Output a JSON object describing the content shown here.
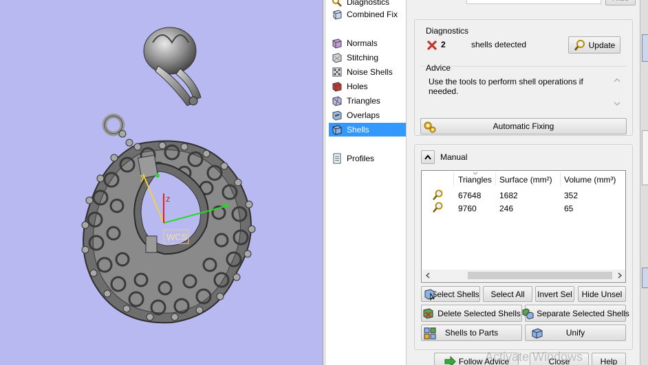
{
  "viewport": {
    "wcs_label": "WCS",
    "axis_y": "y",
    "axis_z": "z",
    "background": "#b9b9f2"
  },
  "tools": {
    "items": [
      {
        "label": "Diagnostics",
        "icon": "diagnostics-icon"
      },
      {
        "label": "Combined Fix",
        "icon": "combined-fix-icon"
      },
      {
        "label": "Normals",
        "icon": "normals-icon"
      },
      {
        "label": "Stitching",
        "icon": "stitching-icon"
      },
      {
        "label": "Noise Shells",
        "icon": "noise-shells-icon"
      },
      {
        "label": "Holes",
        "icon": "holes-icon"
      },
      {
        "label": "Triangles",
        "icon": "triangles-icon"
      },
      {
        "label": "Overlaps",
        "icon": "overlaps-icon"
      },
      {
        "label": "Shells",
        "icon": "shells-icon",
        "selected": true
      },
      {
        "label": "Profiles",
        "icon": "profiles-icon"
      }
    ],
    "selection_color": "#3399ff"
  },
  "diagnostics": {
    "title": "Diagnostics",
    "count": "2",
    "message": "shells detected",
    "update_label": "Update",
    "advice_title": "Advice",
    "advice_text": "Use the tools to perform shell operations if needed.",
    "automatic_fixing_label": "Automatic Fixing"
  },
  "manual": {
    "title": "Manual",
    "columns": [
      "Triangles",
      "Surface (mm²)",
      "Volume (mm³)"
    ],
    "rows": [
      {
        "triangles": "67648",
        "surface": "1682",
        "volume": "352"
      },
      {
        "triangles": "9760",
        "surface": "246",
        "volume": "65"
      }
    ],
    "buttons": {
      "select_shells": "Select Shells",
      "select_all": "Select All",
      "invert_sel": "Invert Sel",
      "hide_unsel": "Hide Unsel",
      "delete_selected": "Delete Selected Shells",
      "separate_selected": "Separate Selected Shells",
      "shells_to_parts": "Shells to Parts",
      "unify": "Unify"
    }
  },
  "footer": {
    "follow_advice": "Follow Advice",
    "close": "Close",
    "help": "Help",
    "top_button": "Hide"
  },
  "watermark": "Activate Windows"
}
